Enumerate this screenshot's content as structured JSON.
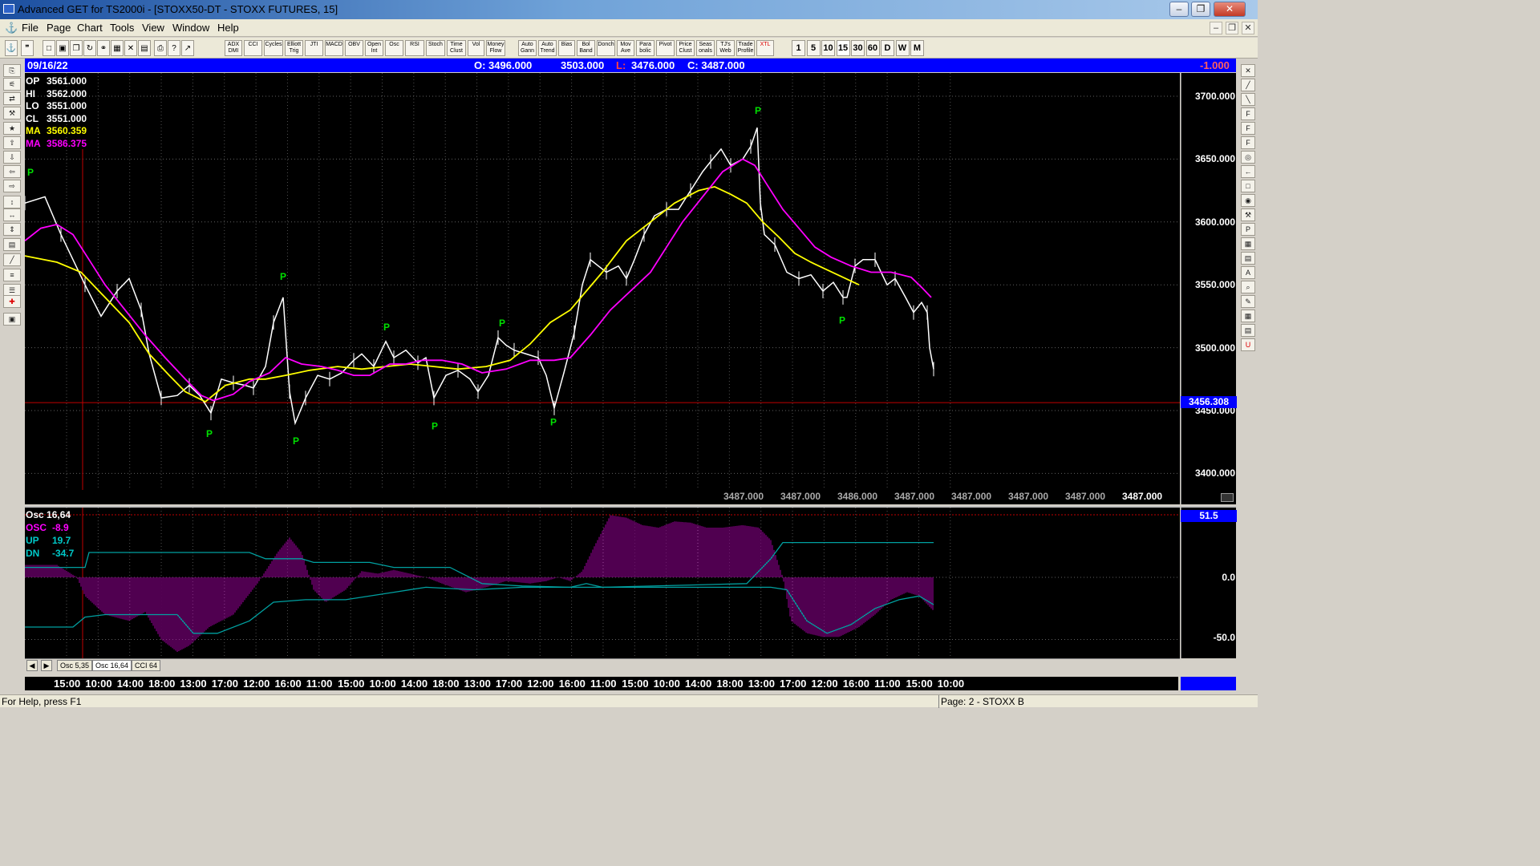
{
  "window": {
    "title": "Advanced GET for TS2000i - [STOXX50-DT - STOXX FUTURES, 15]",
    "minimize": "–",
    "restore": "❐",
    "close": "✕"
  },
  "menu": [
    "File",
    "Page",
    "Chart",
    "Tools",
    "View",
    "Window",
    "Help"
  ],
  "mdi": {
    "minimize": "–",
    "restore": "❐",
    "close": "✕"
  },
  "toolbar": {
    "studies": [
      "ADX DMI",
      "CCI",
      "Cycles",
      "Elliott Trig",
      "JTI",
      "MACD",
      "OBV",
      "Open Int",
      "Osc",
      "RSI",
      "Stoch",
      "Time Clust",
      "Vol",
      "Money Flow"
    ],
    "tools": [
      "Auto Gann",
      "Auto Trend",
      "Bias",
      "Bol Band",
      "Donch",
      "Mov Ave",
      "Para bolic",
      "Pivot",
      "Price Clust",
      "Seas onals",
      "TJ's Web",
      "Trade Profile",
      "XTL"
    ],
    "intervals": [
      "1",
      "5",
      "10",
      "15",
      "30",
      "60",
      "D",
      "W",
      "M"
    ]
  },
  "header": {
    "date": "09/16/22",
    "open": "O: 3496.000",
    "high": "3503.000",
    "low_label": "L:",
    "low": "3476.000",
    "close": "C: 3487.000",
    "change": "-1.000"
  },
  "price_pane": {
    "info": [
      {
        "label": "OP",
        "value": "3561.000",
        "color": "#ffffff"
      },
      {
        "label": "HI",
        "value": "3562.000",
        "color": "#ffffff"
      },
      {
        "label": "LO",
        "value": "3551.000",
        "color": "#ffffff"
      },
      {
        "label": "CL",
        "value": "3551.000",
        "color": "#ffffff"
      },
      {
        "label": "MA",
        "value": "3560.359",
        "color": "#ffff00"
      },
      {
        "label": "MA",
        "value": "3586.375",
        "color": "#ff00ff"
      }
    ],
    "y_ticks": [
      "3700.000",
      "3650.000",
      "3600.000",
      "3550.000",
      "3500.000",
      "3450.000",
      "3400.000"
    ],
    "current_price": "3456.308",
    "bottom_values": [
      "3487.000",
      "3487.000",
      "3486.000",
      "3487.000",
      "3487.000",
      "3487.000",
      "3487.000",
      "3487.000"
    ],
    "pivot_marker": "P"
  },
  "osc_pane": {
    "title": "Osc 16,64",
    "info": [
      {
        "label": "OSC",
        "value": "-8.9",
        "color": "#ff00ff"
      },
      {
        "label": "UP",
        "value": "19.7",
        "color": "#00c8c8"
      },
      {
        "label": "DN",
        "value": "-34.7",
        "color": "#00c8c8"
      }
    ],
    "y_ticks": [
      "0.0",
      "-50.0"
    ],
    "current_value": "51.5"
  },
  "tabs": [
    "Osc 5,35",
    "Osc 16,64",
    "CCI 64"
  ],
  "time_axis": [
    "15:00",
    "10:00",
    "14:00",
    "18:00",
    "13:00",
    "17:00",
    "12:00",
    "16:00",
    "11:00",
    "15:00",
    "10:00",
    "14:00",
    "18:00",
    "13:00",
    "17:00",
    "12:00",
    "16:00",
    "11:00",
    "15:00",
    "10:00",
    "14:00",
    "18:00",
    "13:00",
    "17:00",
    "12:00",
    "16:00",
    "11:00",
    "15:00",
    "10:00"
  ],
  "status": {
    "help": "For Help, press F1",
    "page": "Page: 2 - STOXX B"
  },
  "colors": {
    "price": "#ffffff",
    "ma_fast": "#ffff00",
    "ma_slow": "#ff00ff",
    "pivot": "#00e000",
    "osc": "#c000c0",
    "band": "#00a0a0",
    "current_line": "#c00000",
    "header": "#0000ff"
  }
}
